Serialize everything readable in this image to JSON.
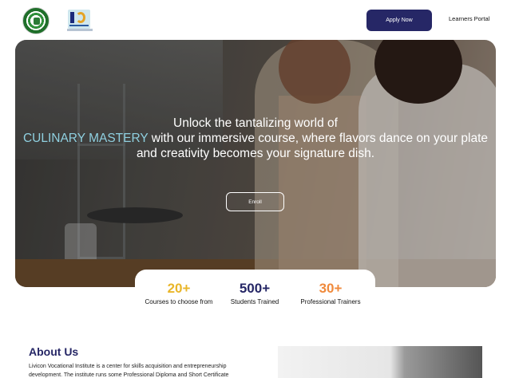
{
  "header": {
    "apply_label": "Apply Now",
    "portal_label": "Learners Portal"
  },
  "hero": {
    "headline_pre": "Unlock the tantalizing world of",
    "headline_accent": "CULINARY MASTERY",
    "headline_post": "with our immersive course, where flavors dance on your plate and creativity becomes your signature dish.",
    "enroll_label": "Enroll"
  },
  "stats": [
    {
      "value": "20+",
      "label": "Courses to choose from"
    },
    {
      "value": "500+",
      "label": "Students Trained"
    },
    {
      "value": "30+",
      "label": "Professional Trainers"
    }
  ],
  "about": {
    "title": "About Us",
    "text": "Livicon Vocational Institute is a center for skills acquisition and entrepreneurship development. The institute runs some Professional Diploma and Short Certificate"
  },
  "colors": {
    "brand": "#262766",
    "accent_cyan": "#8fd0e0",
    "stat_yellow": "#e9b62a",
    "stat_orange": "#f08a3c"
  }
}
